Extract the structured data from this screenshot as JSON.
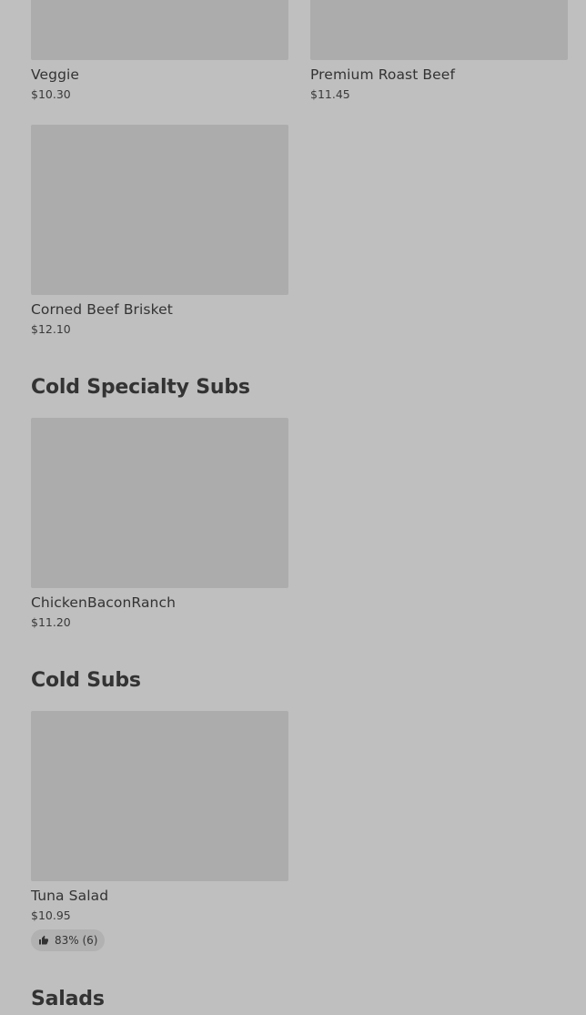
{
  "items": {
    "veggie": {
      "name": "Veggie",
      "price": "$10.30"
    },
    "premium_roast_beef": {
      "name": "Premium Roast Beef",
      "price": "$11.45"
    },
    "corned_beef_brisket": {
      "name": "Corned Beef Brisket",
      "price": "$12.10"
    },
    "chicken_bacon_ranch": {
      "name": "ChickenBaconRanch",
      "price": "$11.20"
    },
    "tuna_salad": {
      "name": "Tuna Salad",
      "price": "$10.95",
      "rating": "83% (6)",
      "rating_icon": "thumbs-up-icon"
    }
  },
  "sections": {
    "cold_specialty_subs": "Cold Specialty Subs",
    "cold_subs": "Cold Subs",
    "salads": "Salads"
  },
  "colors": {
    "overlay_background": "#bfbfbf",
    "image_placeholder": "#acacac",
    "text": "#333333"
  }
}
